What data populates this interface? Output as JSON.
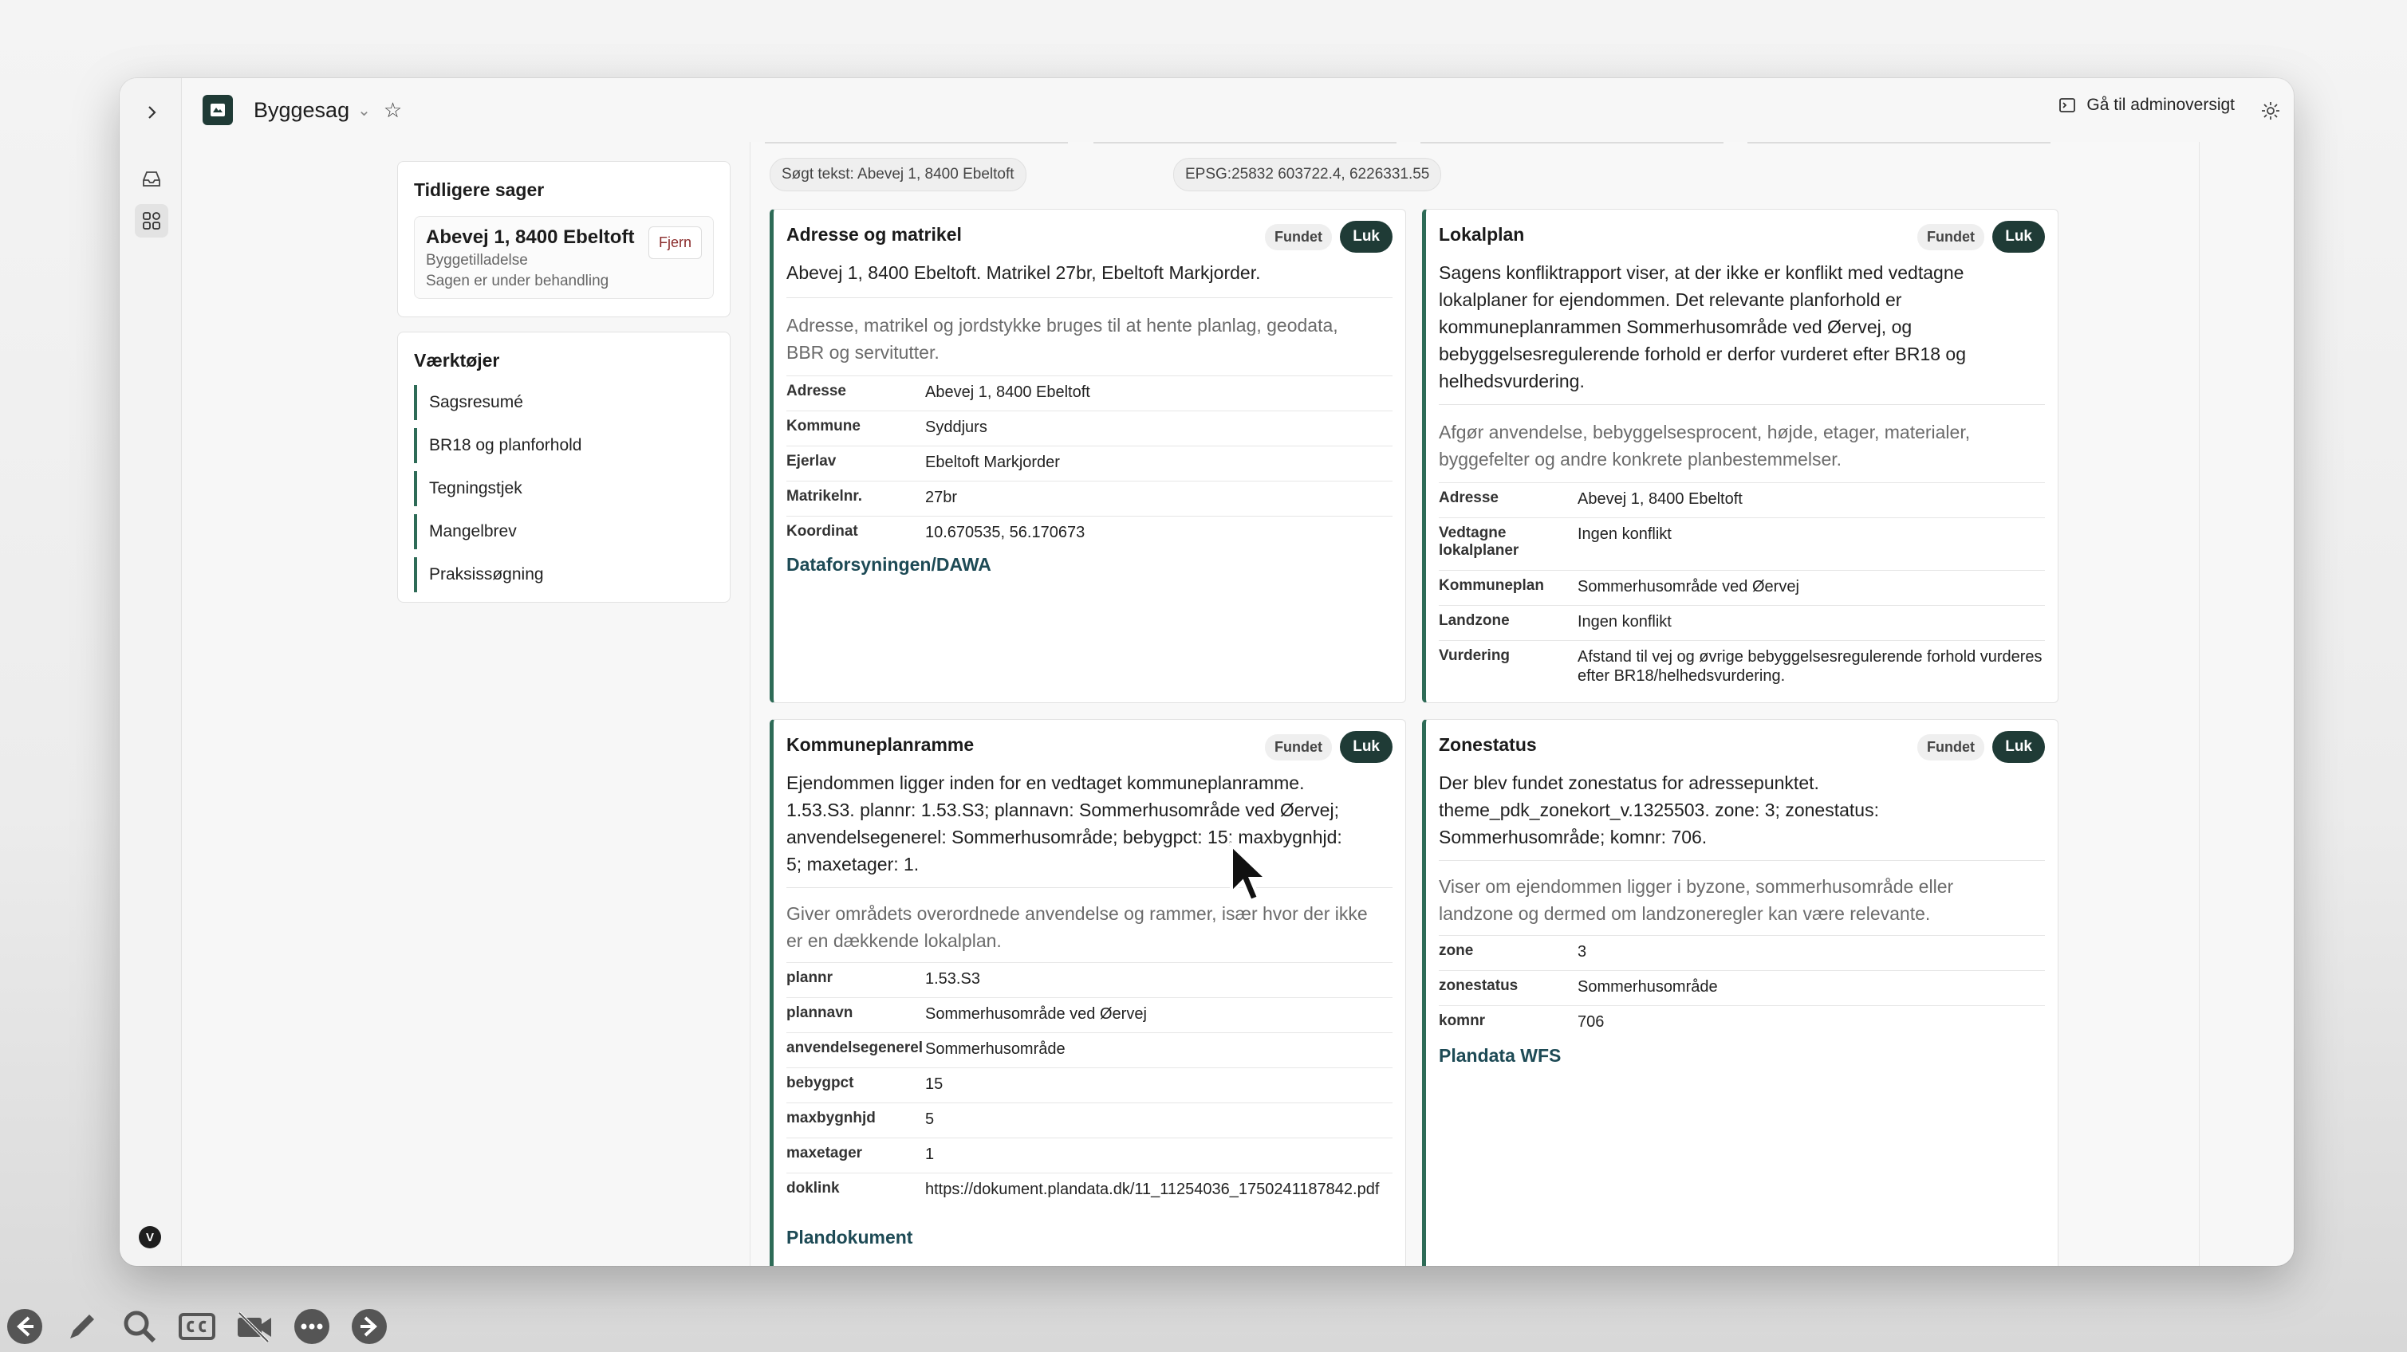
{
  "app": {
    "title": "Byggesag",
    "admin_label": "Gå til adminoversigt",
    "avatar_initial": "V"
  },
  "previous_cases": {
    "title": "Tidligere sager",
    "items": [
      {
        "address": "Abevej 1, 8400 Ebeltoft",
        "type": "Byggetilladelse",
        "status": "Sagen er under behandling",
        "remove_label": "Fjern"
      }
    ]
  },
  "tools": {
    "title": "Værktøjer",
    "items": [
      "Sagsresumé",
      "BR18 og planforhold",
      "Tegningstjek",
      "Mangelbrev",
      "Praksissøgning"
    ]
  },
  "search_pills": [
    "Søgt tekst: Abevej 1, 8400 Ebeltoft",
    "EPSG:25832 603722.4, 6226331.55"
  ],
  "cards": [
    {
      "title": "Adresse og matrikel",
      "status": "Fundet",
      "close_label": "Luk",
      "summary": "Abevej 1, 8400 Ebeltoft. Matrikel 27br, Ebeltoft Markjorder.",
      "description": "Adresse, matrikel og jordstykke bruges til at hente planlag, geodata, BBR og servitutter.",
      "rows": [
        {
          "k": "Adresse",
          "v": "Abevej 1, 8400 Ebeltoft"
        },
        {
          "k": "Kommune",
          "v": "Syddjurs"
        },
        {
          "k": "Ejerlav",
          "v": "Ebeltoft Markjorder"
        },
        {
          "k": "Matrikelnr.",
          "v": "27br"
        },
        {
          "k": "Koordinat",
          "v": "10.670535, 56.170673"
        }
      ],
      "source": "Dataforsyningen/DAWA"
    },
    {
      "title": "Lokalplan",
      "status": "Fundet",
      "close_label": "Luk",
      "summary": "Sagens konfliktrapport viser, at der ikke er konflikt med vedtagne lokalplaner for ejendommen. Det relevante planforhold er kommuneplanrammen Sommerhusområde ved Øervej, og bebyggelsesregulerende forhold er derfor vurderet efter BR18 og helhedsvurdering.",
      "description": "Afgør anvendelse, bebyggelsesprocent, højde, etager, materialer, byggefelter og andre konkrete planbestemmelser.",
      "rows": [
        {
          "k": "Adresse",
          "v": "Abevej 1, 8400 Ebeltoft"
        },
        {
          "k": "Vedtagne lokalplaner",
          "v": "Ingen konflikt"
        },
        {
          "k": "Kommuneplan",
          "v": "Sommerhusområde ved Øervej"
        },
        {
          "k": "Landzone",
          "v": "Ingen konflikt"
        },
        {
          "k": "Vurdering",
          "v": "Afstand til vej og øvrige bebyggelsesregulerende forhold vurderes efter BR18/helhedsvurdering."
        }
      ]
    },
    {
      "title": "Kommuneplanramme",
      "status": "Fundet",
      "close_label": "Luk",
      "summary": "Ejendommen ligger inden for en vedtaget kommuneplanramme. 1.53.S3. plannr: 1.53.S3; plannavn: Sommerhusområde ved Øervej; anvendelsegenerel: Sommerhusområde; bebygpct: 15; maxbygnhjd: 5; maxetager: 1.",
      "description": "Giver områdets overordnede anvendelse og rammer, især hvor der ikke er en dækkende lokalplan.",
      "rows": [
        {
          "k": "plannr",
          "v": "1.53.S3"
        },
        {
          "k": "plannavn",
          "v": "Sommerhusområde ved Øervej"
        },
        {
          "k": "anvendelsegenerel",
          "v": "Sommerhusområde"
        },
        {
          "k": "bebygpct",
          "v": "15"
        },
        {
          "k": "maxbygnhjd",
          "v": "5"
        },
        {
          "k": "maxetager",
          "v": "1"
        },
        {
          "k": "doklink",
          "v": "https://dokument.plandata.dk/11_11254036_1750241187842.pdf"
        }
      ],
      "source": "Plandokument"
    },
    {
      "title": "Zonestatus",
      "status": "Fundet",
      "close_label": "Luk",
      "summary": "Der blev fundet zonestatus for adressepunktet. theme_pdk_zonekort_v.1325503. zone: 3; zonestatus: Sommerhusområde; komnr: 706.",
      "description": "Viser om ejendommen ligger i byzone, sommerhusområde eller landzone og dermed om landzoneregler kan være relevante.",
      "rows": [
        {
          "k": "zone",
          "v": "3"
        },
        {
          "k": "zonestatus",
          "v": "Sommerhusområde"
        },
        {
          "k": "komnr",
          "v": "706"
        }
      ],
      "source": "Plandata WFS"
    }
  ],
  "colors": {
    "accent": "#2e6b57",
    "dark": "#1f3b36",
    "link": "#1d4a55"
  }
}
